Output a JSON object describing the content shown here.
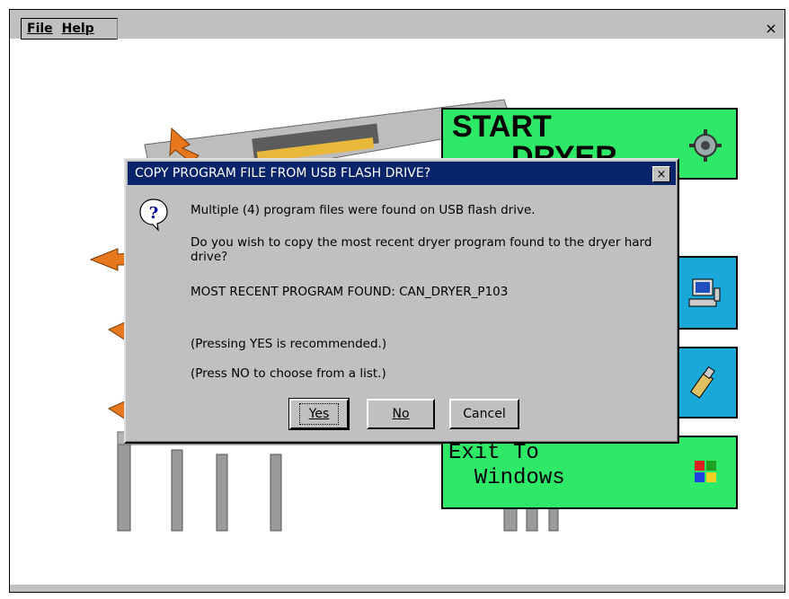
{
  "menubar": {
    "items": [
      "File",
      "Help"
    ],
    "close_glyph": "×"
  },
  "tiles": {
    "start": {
      "line1": "START",
      "line2": "DRYER"
    },
    "exit": {
      "text": "Exit To\n  Windows"
    }
  },
  "dialog": {
    "title": "COPY PROGRAM FILE FROM USB FLASH DRIVE?",
    "close_glyph": "×",
    "icon": "question-icon",
    "lines": [
      "Multiple (4) program files were found on USB flash drive.",
      "Do you wish to copy the most recent dryer program found to the dryer hard drive?",
      "MOST RECENT PROGRAM FOUND: CAN_DRYER_P103",
      "(Pressing YES is recommended.)",
      "(Press NO to choose from a list.)"
    ],
    "buttons": {
      "yes": "Yes",
      "no": "No",
      "cancel": "Cancel"
    }
  },
  "colors": {
    "title_bar": "#08246b",
    "tile_green": "#2ee867",
    "tile_blue": "#1aa8d8",
    "chrome": "#c0c0c0"
  }
}
